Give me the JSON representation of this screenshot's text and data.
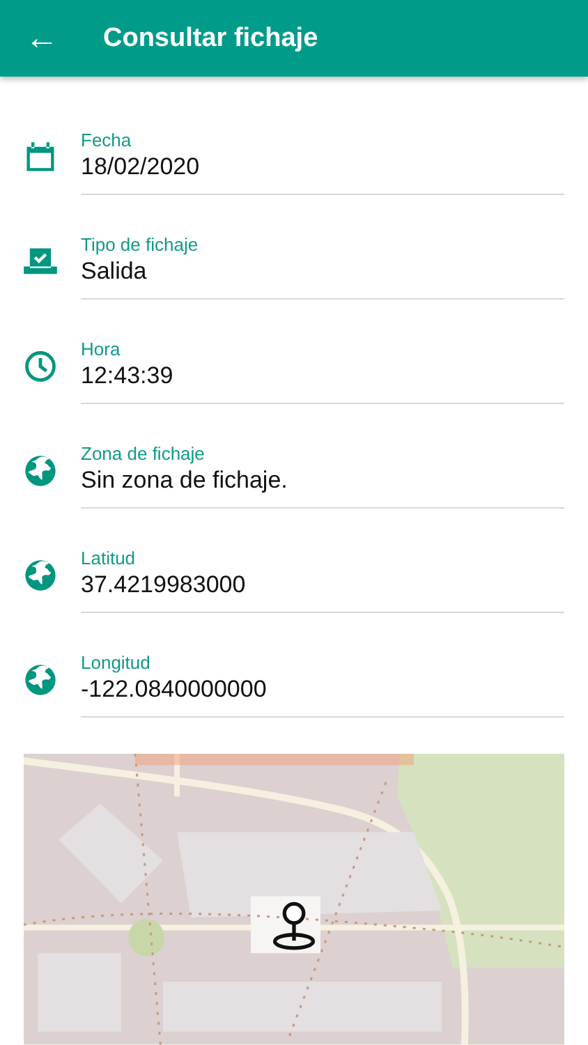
{
  "app_bar": {
    "back": "←",
    "title": "Consultar fichaje"
  },
  "fields": [
    {
      "kind": "calendar",
      "label": "Fecha",
      "value": "18/02/2020"
    },
    {
      "kind": "tray",
      "label": "Tipo de fichaje",
      "value": "Salida"
    },
    {
      "kind": "clock",
      "label": "Hora",
      "value": "12:43:39"
    },
    {
      "kind": "globe",
      "label": "Zona de fichaje",
      "value": "Sin zona de fichaje."
    },
    {
      "kind": "globe",
      "label": "Latitud",
      "value": "37.4219983000"
    },
    {
      "kind": "globe",
      "label": "Longitud",
      "value": "-122.0840000000"
    }
  ]
}
